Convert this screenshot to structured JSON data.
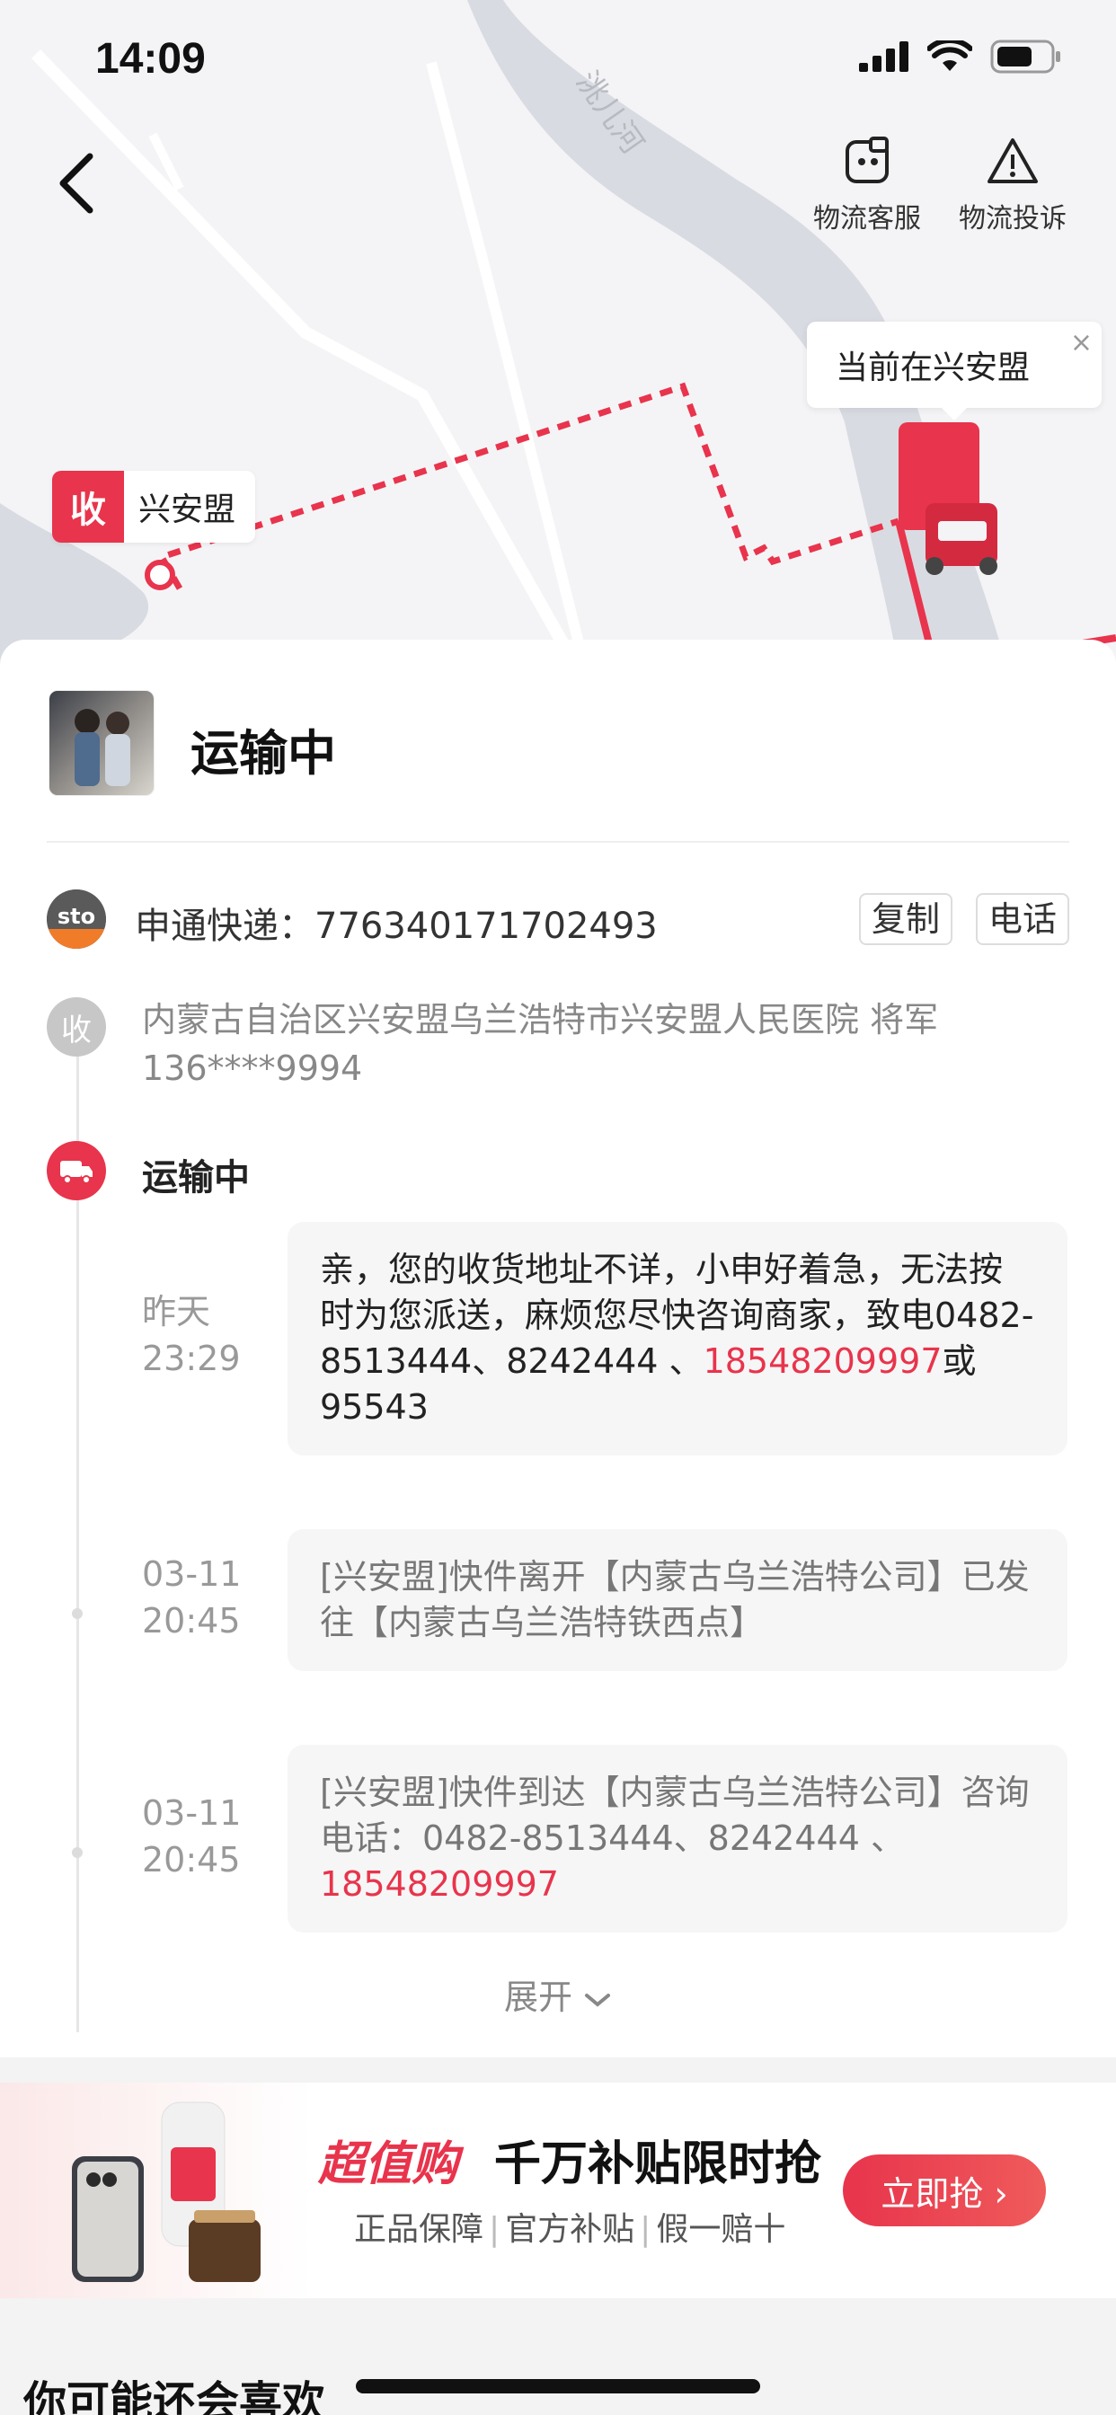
{
  "status_bar": {
    "time": "14:09"
  },
  "map": {
    "river_label": "洮儿河",
    "current_tip": "当前在兴安盟",
    "current_tip_close": "×",
    "receive_badge": "收",
    "receive_place": "兴安盟"
  },
  "top_actions": [
    {
      "label": "物流客服",
      "icon": "customer-service-icon"
    },
    {
      "label": "物流投诉",
      "icon": "warning-icon"
    }
  ],
  "card": {
    "title": "运输中",
    "carrier": "申通快递：776340171702493",
    "carrier_logo": "sto",
    "copy_label": "复制",
    "phone_label": "电话",
    "recv_icon": "收",
    "address": "内蒙古自治区兴安盟乌兰浩特市兴安盟人民医院 将军 136****9994",
    "status_label": "运输中",
    "events": [
      {
        "date": "昨天",
        "time": "23:29",
        "text_a": "亲，您的收货地址不详，小申好着急，无法按时为您派送，麻烦您尽快咨询商家，致电0482-8513444、8242444 、",
        "phone": "18548209997",
        "text_b": "或95543"
      },
      {
        "date": "03-11",
        "time": "20:45",
        "text_a": "[兴安盟]快件离开【内蒙古乌兰浩特公司】已发往【内蒙古乌兰浩特铁西点】"
      },
      {
        "date": "03-11",
        "time": "20:45",
        "text_a": "[兴安盟]快件到达【内蒙古乌兰浩特公司】咨询电话：0482-8513444、8242444 、",
        "phone": "18548209997"
      }
    ],
    "expand_label": "展开"
  },
  "banner": {
    "brand": "超值购",
    "title": "千万补贴限时抢",
    "tags": [
      "正品保障",
      "官方补贴",
      "假一赔十"
    ],
    "cta": "立即抢 ›"
  },
  "recommend_title": "你可能还会喜欢",
  "colors": {
    "accent": "#e8344c",
    "route": "#e8344c"
  }
}
